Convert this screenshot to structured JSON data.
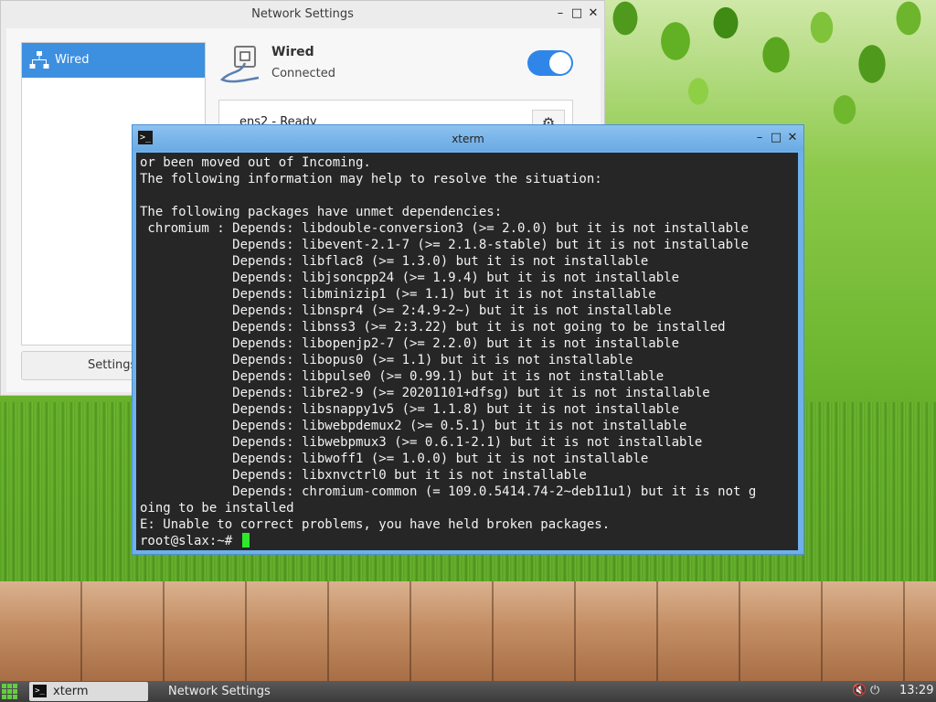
{
  "network_window": {
    "title": "Network Settings",
    "sidebar": {
      "items": [
        {
          "label": "Wired",
          "selected": true
        }
      ]
    },
    "settings_button_label": "Settings",
    "wired": {
      "title": "Wired",
      "status": "Connected",
      "enabled": true
    },
    "connection": {
      "name": "ens2 - Ready"
    }
  },
  "xterm": {
    "title": "xterm",
    "lines": [
      "or been moved out of Incoming.",
      "The following information may help to resolve the situation:",
      "",
      "The following packages have unmet dependencies:",
      " chromium : Depends: libdouble-conversion3 (>= 2.0.0) but it is not installable",
      "            Depends: libevent-2.1-7 (>= 2.1.8-stable) but it is not installable",
      "            Depends: libflac8 (>= 1.3.0) but it is not installable",
      "            Depends: libjsoncpp24 (>= 1.9.4) but it is not installable",
      "            Depends: libminizip1 (>= 1.1) but it is not installable",
      "            Depends: libnspr4 (>= 2:4.9-2~) but it is not installable",
      "            Depends: libnss3 (>= 2:3.22) but it is not going to be installed",
      "            Depends: libopenjp2-7 (>= 2.2.0) but it is not installable",
      "            Depends: libopus0 (>= 1.1) but it is not installable",
      "            Depends: libpulse0 (>= 0.99.1) but it is not installable",
      "            Depends: libre2-9 (>= 20201101+dfsg) but it is not installable",
      "            Depends: libsnappy1v5 (>= 1.1.8) but it is not installable",
      "            Depends: libwebpdemux2 (>= 0.5.1) but it is not installable",
      "            Depends: libwebpmux3 (>= 0.6.1-2.1) but it is not installable",
      "            Depends: libwoff1 (>= 1.0.0) but it is not installable",
      "            Depends: libxnvctrl0 but it is not installable",
      "            Depends: chromium-common (= 109.0.5414.74-2~deb11u1) but it is not g",
      "oing to be installed",
      "E: Unable to correct problems, you have held broken packages."
    ],
    "prompt": "root@slax:~# "
  },
  "taskbar": {
    "tasks": [
      {
        "label": "xterm",
        "active": true
      },
      {
        "label": "Network Settings",
        "active": false
      }
    ],
    "clock": "13:29"
  },
  "colors": {
    "accent": "#3d8fe0",
    "terminal_bg": "#262626",
    "terminal_fg": "#f2f2f2",
    "cursor": "#2ee82e"
  },
  "icons": [
    "network-wired-icon",
    "terminal-icon",
    "gear-icon",
    "volume-muted-icon",
    "power-icon",
    "app-menu-icon"
  ]
}
